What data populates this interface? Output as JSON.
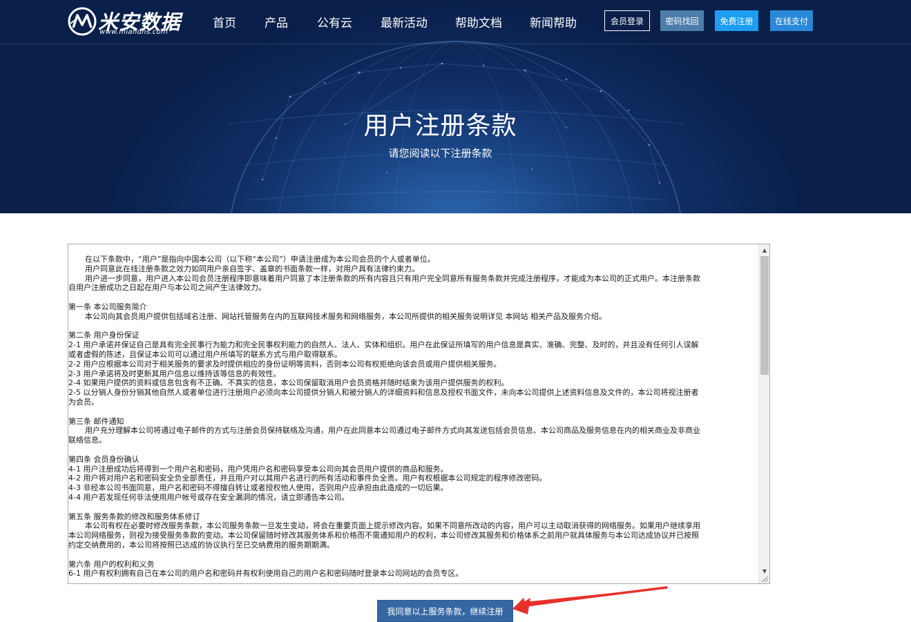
{
  "header": {
    "logo_text": "米安数据",
    "logo_url": "www.miandns.com",
    "nav": [
      {
        "label": "首页"
      },
      {
        "label": "产品"
      },
      {
        "label": "公有云"
      },
      {
        "label": "最新活动"
      },
      {
        "label": "帮助文档"
      },
      {
        "label": "新闻帮助"
      }
    ],
    "buttons": {
      "login": "会员登录",
      "recover": "密码找回",
      "register": "免费注册",
      "pay": "在线支付"
    }
  },
  "hero": {
    "title": "用户注册条款",
    "subtitle": "请您阅读以下注册条款"
  },
  "terms": {
    "lines": [
      {
        "text": "在以下条款中，“用户”是指向中国本公司（以下称“本公司”）申请注册成为本公司会员的个人或者单位。",
        "indent": true
      },
      {
        "text": "用户同意此在线注册条款之效力如同用户亲自签字、盖章的书面条款一样，对用户具有法律约束力。",
        "indent": true
      },
      {
        "text": "用户进一步同意，用户进入本公司会员注册程序即意味着用户同意了本注册条款的所有内容且只有用户完全同意所有服务条款并完成注册程序，才能成为本公司的正式用户。本注册条款",
        "indent": true
      },
      {
        "text": "自用户注册成功之日起在用户与本公司之间产生法律效力。",
        "indent": false
      },
      {
        "text": "",
        "indent": false
      },
      {
        "text": "第一条   本公司服务简介",
        "indent": false
      },
      {
        "text": "本公司向其会员用户提供包括域名注册、网站托管服务在内的互联网技术服务和网络服务，本公司所提供的相关服务说明详见 本网站 相关产品及服务介绍。",
        "indent": true
      },
      {
        "text": "",
        "indent": false
      },
      {
        "text": "第二条   用户身份保证",
        "indent": false
      },
      {
        "text": "2-1 用户承诺并保证自己是具有完全民事行为能力和完全民事权利能力的自然人、法人、实体和组织。用户在此保证所填写的用户信息是真实、准确、完整、及时的，并且没有任何引人误解",
        "indent": false
      },
      {
        "text": "或者虚假的陈述，且保证本公司可以通过用户所填写的联系方式与用户取得联系。",
        "indent": false
      },
      {
        "text": "2-2 用户应根据本公司对于相关服务的要求及时提供相应的身份证明等资料，否则本公司有权拒绝向该会员或用户提供相关服务。",
        "indent": false
      },
      {
        "text": "2-3 用户承诺将及时更新其用户信息以维持该等信息的有效性。",
        "indent": false
      },
      {
        "text": "2-4 如果用户提供的资料或信息包含有不正确、不真实的信息，本公司保留取消用户会员资格并随时结束为该用户提供服务的权利。",
        "indent": false
      },
      {
        "text": "2-5 以分销人身份分销其他自然人或者单位进行注册用户必须向本公司提供分销人和被分销人的详细资料和信息及授权书面文件，未向本公司提供上述资料信息及文件的，本公司将视注册者",
        "indent": false
      },
      {
        "text": "为会员。",
        "indent": false
      },
      {
        "text": "",
        "indent": false
      },
      {
        "text": "第三条   邮件通知",
        "indent": false
      },
      {
        "text": "用户充分理解本公司将通过电子邮件的方式与注册会员保持联络及沟通，用户在此同意本公司通过电子邮件方式向其发送包括会员信息、本公司商品及服务信息在内的相关商业及非商业",
        "indent": true
      },
      {
        "text": "联络信息。",
        "indent": false
      },
      {
        "text": "",
        "indent": false
      },
      {
        "text": "第四条   会员身份确认",
        "indent": false
      },
      {
        "text": "4-1 用户注册成功后将得到一个用户名和密码，用户凭用户名和密码享受本公司向其会员用户提供的商品和服务。",
        "indent": false
      },
      {
        "text": "4-2 用户将对用户名和密码安全负全部责任，并且用户对以其用户名进行的所有活动和事件负全责。用户有权根据本公司规定的程序修改密码。",
        "indent": false
      },
      {
        "text": "4-3 非经本公司书面同意，用户名和密码不得擅自转让或者授权他人使用，否则用户应承担由此造成的一切后果。",
        "indent": false
      },
      {
        "text": "4-4 用户若发现任何非法使用用户帐号或存在安全漏洞的情况，请立即通告本公司。",
        "indent": false
      },
      {
        "text": "",
        "indent": false
      },
      {
        "text": "第五条   服务条款的修改和服务体系修订",
        "indent": false
      },
      {
        "text": "本公司有权在必要时修改服务条款，本公司服务条款一旦发生变动，将会在重要页面上提示修改内容。如果不同意所改动的内容，用户可以主动取消获得的网络服务。如果用户继续享用",
        "indent": true
      },
      {
        "text": "本公司网络服务，则视为接受服务条款的变动。本公司保留随时修改其服务体系和价格而不需通知用户的权利，本公司修改其服务和价格体系之前用户就具体服务与本公司达成协议并已按照",
        "indent": false
      },
      {
        "text": "约定交纳费用的，本公司将按照已达成的协议执行至已交纳费用的服务期期满。",
        "indent": false
      },
      {
        "text": "",
        "indent": false
      },
      {
        "text": "第六条   用户的权利和义务",
        "indent": false
      },
      {
        "text": "6-1 用户有权利拥有自己在本公司的用户名和密码并有权利使用自己的用户名和密码随时登录本公司网站的会员专区。",
        "indent": false
      }
    ]
  },
  "agree_button": "我同意以上服务条款，继续注册",
  "colors": {
    "hero_dark": "#0a1f4a",
    "hero_light": "#2e6cb4",
    "btn_recover": "#4d7daa",
    "btn_register": "#1e9df3",
    "btn_pay": "#2a88d8",
    "agree": "#3567a3",
    "annotation": "#e8302a"
  }
}
